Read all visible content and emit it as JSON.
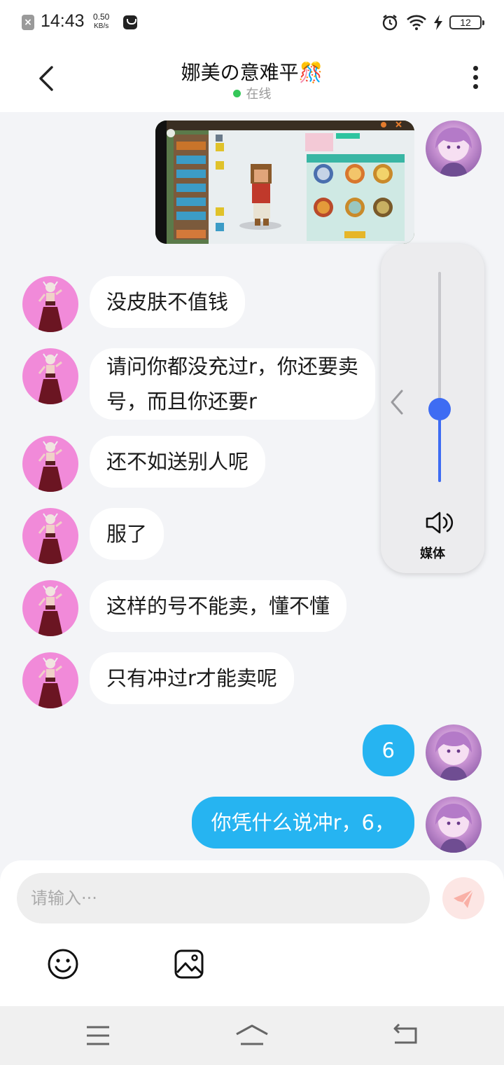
{
  "status_bar": {
    "time": "14:43",
    "speed_value": "0.50",
    "speed_unit": "KB/s",
    "battery": "12",
    "icons": [
      "close-notification-icon",
      "app-notification-icon",
      "alarm-icon",
      "wifi-icon",
      "charging-icon",
      "battery-icon"
    ]
  },
  "header": {
    "title": "娜美の意难平🎊",
    "status": "在线",
    "status_color": "#35c759",
    "icons": [
      "back-arrow-icon",
      "more-vert-icon"
    ]
  },
  "messages": [
    {
      "side": "right",
      "type": "image",
      "description_icon": "game-screenshot"
    },
    {
      "side": "left",
      "type": "text",
      "lines": [
        "没皮肤不值钱"
      ]
    },
    {
      "side": "left",
      "type": "text",
      "lines": [
        "请问你都没充过r，你还要卖",
        "号，而且你还要r"
      ]
    },
    {
      "side": "left",
      "type": "text",
      "lines": [
        "还不如送别人呢"
      ]
    },
    {
      "side": "left",
      "type": "text",
      "lines": [
        "服了"
      ]
    },
    {
      "side": "left",
      "type": "text",
      "lines": [
        "这样的号不能卖，懂不懂"
      ]
    },
    {
      "side": "left",
      "type": "text",
      "lines": [
        "只有冲过r才能卖呢"
      ]
    },
    {
      "side": "right",
      "type": "text",
      "lines": [
        "6"
      ]
    },
    {
      "side": "right",
      "type": "text",
      "lines": [
        "你凭什么说冲r，6，"
      ]
    }
  ],
  "volume_panel": {
    "label": "媒体",
    "level": 0.35,
    "accent": "#3e6cf3"
  },
  "input": {
    "placeholder": "请输入···",
    "icons": [
      "send-icon",
      "emoji-icon",
      "image-icon"
    ]
  },
  "colors": {
    "my_bubble": "#26b4f1",
    "other_bubble": "#ffffff",
    "background": "#f3f4f7"
  },
  "nav": {
    "icons": [
      "menu-icon",
      "home-icon",
      "back-icon"
    ]
  }
}
